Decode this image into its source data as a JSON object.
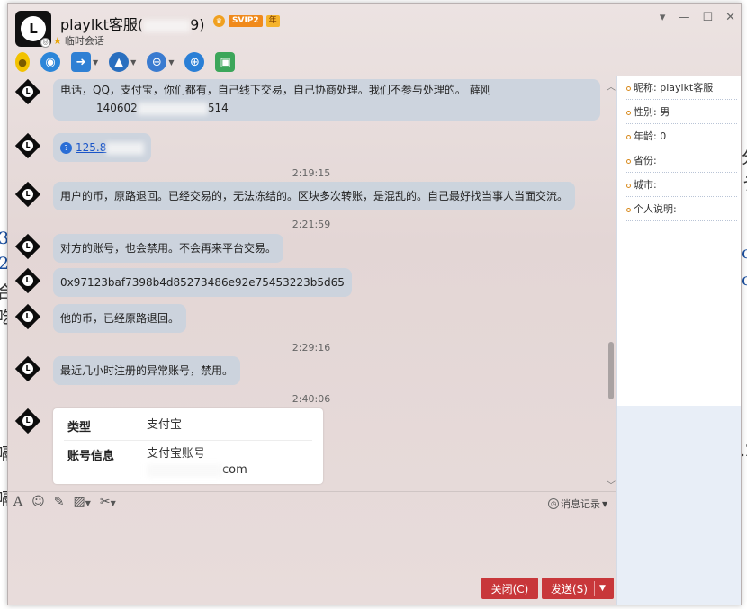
{
  "window": {
    "title_prefix": "playlkt客服(",
    "title_suffix": "9)",
    "svip_label": "SVIP2",
    "year_label": "年",
    "subtitle": "临时会话",
    "avatar_letter": "L"
  },
  "messages": [
    {
      "type": "text",
      "lines": [
        "电话，QQ，支付宝，你们都有，自己线下交易，自己协商处理。我们不参与处理的。       薛刚",
        "140602",
        "514"
      ]
    },
    {
      "type": "link",
      "text": "125.8"
    },
    {
      "type": "time",
      "text": "2:19:15"
    },
    {
      "type": "text",
      "text": "用户的币，原路退回。已经交易的，无法冻结的。区块多次转账，是混乱的。自己最好找当事人当面交流。"
    },
    {
      "type": "time",
      "text": "2:21:59"
    },
    {
      "type": "text",
      "text": "对方的账号，也会禁用。不会再来平台交易。"
    },
    {
      "type": "text",
      "text": "0x97123baf7398b4d85273486e92e75453223b5d65"
    },
    {
      "type": "text",
      "text": "他的币，已经原路退回。"
    },
    {
      "type": "time",
      "text": "2:29:16"
    },
    {
      "type": "text",
      "text": "最近几小时注册的异常账号，禁用。"
    },
    {
      "type": "time",
      "text": "2:40:06"
    },
    {
      "type": "card",
      "rows": [
        {
          "key": "类型",
          "value": "支付宝"
        },
        {
          "key": "账号信息",
          "value": "支付宝账号",
          "value2": "com"
        }
      ]
    }
  ],
  "profile": [
    {
      "label": "昵称:",
      "value": "playlkt客服"
    },
    {
      "label": "性别:",
      "value": "男"
    },
    {
      "label": "年龄:",
      "value": "0"
    },
    {
      "label": "省份:",
      "value": ""
    },
    {
      "label": "城市:",
      "value": ""
    },
    {
      "label": "个人说明:",
      "value": ""
    }
  ],
  "input_toolbar": {
    "history_label": "消息记录"
  },
  "buttons": {
    "close": "关闭(C)",
    "send": "发送(S)"
  },
  "background_fragments": {
    "f1": "3",
    "f2": "2",
    "f3": "合",
    "f4": "吃",
    "f5": "分",
    "f6": "ゔ",
    "f7": "o",
    "f8": "c",
    "f9": "嗝",
    "f10": ".2",
    "f11": "嗝",
    "f12": "f"
  },
  "colors": {
    "send_button": "#c8373a",
    "bubble": "#c8d2de",
    "link": "#1a55c8",
    "svip": "#f08a1c"
  },
  "icons": {
    "toolbar": [
      "microphone-icon",
      "video-call-icon",
      "file-transfer-icon",
      "remote-assist-icon",
      "remove-user-icon",
      "add-user-icon",
      "chat-app-icon"
    ],
    "input": [
      "font-icon",
      "emoji-icon",
      "screenshot-edit-icon",
      "image-icon",
      "scissors-icon"
    ]
  }
}
